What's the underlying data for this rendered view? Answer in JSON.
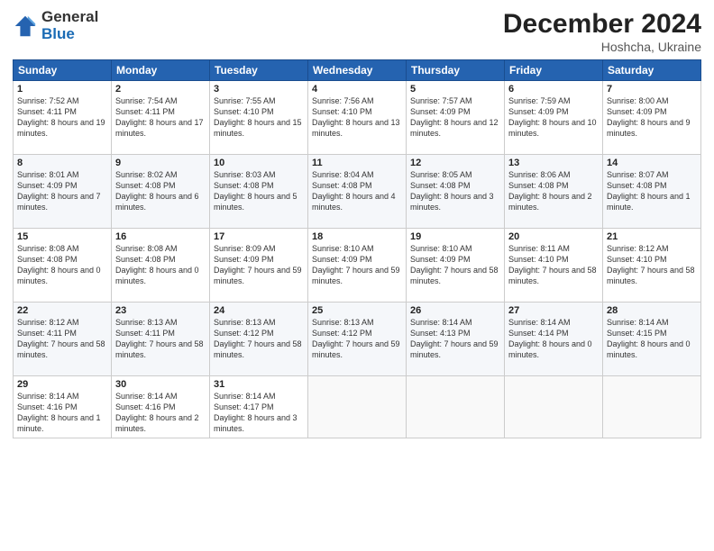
{
  "logo": {
    "general": "General",
    "blue": "Blue"
  },
  "title": "December 2024",
  "subtitle": "Hoshcha, Ukraine",
  "days": [
    "Sunday",
    "Monday",
    "Tuesday",
    "Wednesday",
    "Thursday",
    "Friday",
    "Saturday"
  ],
  "cells": [
    [
      {
        "num": "1",
        "sunrise": "7:52 AM",
        "sunset": "4:11 PM",
        "daylight": "8 hours and 19 minutes."
      },
      {
        "num": "2",
        "sunrise": "7:54 AM",
        "sunset": "4:11 PM",
        "daylight": "8 hours and 17 minutes."
      },
      {
        "num": "3",
        "sunrise": "7:55 AM",
        "sunset": "4:10 PM",
        "daylight": "8 hours and 15 minutes."
      },
      {
        "num": "4",
        "sunrise": "7:56 AM",
        "sunset": "4:10 PM",
        "daylight": "8 hours and 13 minutes."
      },
      {
        "num": "5",
        "sunrise": "7:57 AM",
        "sunset": "4:09 PM",
        "daylight": "8 hours and 12 minutes."
      },
      {
        "num": "6",
        "sunrise": "7:59 AM",
        "sunset": "4:09 PM",
        "daylight": "8 hours and 10 minutes."
      },
      {
        "num": "7",
        "sunrise": "8:00 AM",
        "sunset": "4:09 PM",
        "daylight": "8 hours and 9 minutes."
      }
    ],
    [
      {
        "num": "8",
        "sunrise": "8:01 AM",
        "sunset": "4:09 PM",
        "daylight": "8 hours and 7 minutes."
      },
      {
        "num": "9",
        "sunrise": "8:02 AM",
        "sunset": "4:08 PM",
        "daylight": "8 hours and 6 minutes."
      },
      {
        "num": "10",
        "sunrise": "8:03 AM",
        "sunset": "4:08 PM",
        "daylight": "8 hours and 5 minutes."
      },
      {
        "num": "11",
        "sunrise": "8:04 AM",
        "sunset": "4:08 PM",
        "daylight": "8 hours and 4 minutes."
      },
      {
        "num": "12",
        "sunrise": "8:05 AM",
        "sunset": "4:08 PM",
        "daylight": "8 hours and 3 minutes."
      },
      {
        "num": "13",
        "sunrise": "8:06 AM",
        "sunset": "4:08 PM",
        "daylight": "8 hours and 2 minutes."
      },
      {
        "num": "14",
        "sunrise": "8:07 AM",
        "sunset": "4:08 PM",
        "daylight": "8 hours and 1 minute."
      }
    ],
    [
      {
        "num": "15",
        "sunrise": "8:08 AM",
        "sunset": "4:08 PM",
        "daylight": "8 hours and 0 minutes."
      },
      {
        "num": "16",
        "sunrise": "8:08 AM",
        "sunset": "4:08 PM",
        "daylight": "8 hours and 0 minutes."
      },
      {
        "num": "17",
        "sunrise": "8:09 AM",
        "sunset": "4:09 PM",
        "daylight": "7 hours and 59 minutes."
      },
      {
        "num": "18",
        "sunrise": "8:10 AM",
        "sunset": "4:09 PM",
        "daylight": "7 hours and 59 minutes."
      },
      {
        "num": "19",
        "sunrise": "8:10 AM",
        "sunset": "4:09 PM",
        "daylight": "7 hours and 58 minutes."
      },
      {
        "num": "20",
        "sunrise": "8:11 AM",
        "sunset": "4:10 PM",
        "daylight": "7 hours and 58 minutes."
      },
      {
        "num": "21",
        "sunrise": "8:12 AM",
        "sunset": "4:10 PM",
        "daylight": "7 hours and 58 minutes."
      }
    ],
    [
      {
        "num": "22",
        "sunrise": "8:12 AM",
        "sunset": "4:11 PM",
        "daylight": "7 hours and 58 minutes."
      },
      {
        "num": "23",
        "sunrise": "8:13 AM",
        "sunset": "4:11 PM",
        "daylight": "7 hours and 58 minutes."
      },
      {
        "num": "24",
        "sunrise": "8:13 AM",
        "sunset": "4:12 PM",
        "daylight": "7 hours and 58 minutes."
      },
      {
        "num": "25",
        "sunrise": "8:13 AM",
        "sunset": "4:12 PM",
        "daylight": "7 hours and 59 minutes."
      },
      {
        "num": "26",
        "sunrise": "8:14 AM",
        "sunset": "4:13 PM",
        "daylight": "7 hours and 59 minutes."
      },
      {
        "num": "27",
        "sunrise": "8:14 AM",
        "sunset": "4:14 PM",
        "daylight": "8 hours and 0 minutes."
      },
      {
        "num": "28",
        "sunrise": "8:14 AM",
        "sunset": "4:15 PM",
        "daylight": "8 hours and 0 minutes."
      }
    ],
    [
      {
        "num": "29",
        "sunrise": "8:14 AM",
        "sunset": "4:16 PM",
        "daylight": "8 hours and 1 minute."
      },
      {
        "num": "30",
        "sunrise": "8:14 AM",
        "sunset": "4:16 PM",
        "daylight": "8 hours and 2 minutes."
      },
      {
        "num": "31",
        "sunrise": "8:14 AM",
        "sunset": "4:17 PM",
        "daylight": "8 hours and 3 minutes."
      },
      null,
      null,
      null,
      null
    ]
  ]
}
